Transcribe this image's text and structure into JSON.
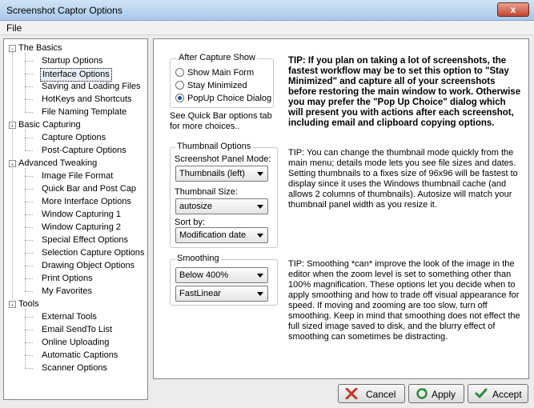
{
  "window": {
    "title": "Screenshot Captor Options",
    "close": "x"
  },
  "menubar": {
    "file": "File"
  },
  "tree": [
    {
      "label": "The Basics",
      "level": 0,
      "expander": "-"
    },
    {
      "label": "Startup Options",
      "level": 1
    },
    {
      "label": "Interface Options",
      "level": 1,
      "selected": true
    },
    {
      "label": "Saving and Loading Files",
      "level": 1
    },
    {
      "label": "HotKeys and Shortcuts",
      "level": 1
    },
    {
      "label": "File Naming Template",
      "level": 1
    },
    {
      "label": "Basic Capturing",
      "level": 0,
      "expander": "-"
    },
    {
      "label": "Capture Options",
      "level": 1
    },
    {
      "label": "Post-Capture Options",
      "level": 1
    },
    {
      "label": "Advanced Tweaking",
      "level": 0,
      "expander": "-"
    },
    {
      "label": "Image File Format",
      "level": 1
    },
    {
      "label": "Quick Bar and Post Cap",
      "level": 1
    },
    {
      "label": "More Interface Options",
      "level": 1
    },
    {
      "label": "Window Capturing 1",
      "level": 1
    },
    {
      "label": "Window Capturing 2",
      "level": 1
    },
    {
      "label": "Special Effect Options",
      "level": 1
    },
    {
      "label": "Selection Capture Options",
      "level": 1
    },
    {
      "label": "Drawing Object Options",
      "level": 1
    },
    {
      "label": "Print Options",
      "level": 1
    },
    {
      "label": "My Favorites",
      "level": 1
    },
    {
      "label": "Tools",
      "level": 0,
      "expander": "-"
    },
    {
      "label": "External Tools",
      "level": 1
    },
    {
      "label": "Email SendTo List",
      "level": 1
    },
    {
      "label": "Online Uploading",
      "level": 1
    },
    {
      "label": "Automatic Captions",
      "level": 1
    },
    {
      "label": "Scanner Options",
      "level": 1
    }
  ],
  "after_capture": {
    "legend": "After Capture Show",
    "options": [
      {
        "label": "Show Main Form",
        "checked": false
      },
      {
        "label": "Stay Minimized",
        "checked": false
      },
      {
        "label": "PopUp Choice Dialog",
        "checked": true
      }
    ],
    "note": "See Quick Bar options tab\nfor more choices.."
  },
  "tip1": "TIP: If you plan on taking a lot of screenshots, the fastest workflow may be to set this option to \"Stay Minimized\" and capture all of your screenshots before restoring the main window to work. Otherwise you may prefer the \"Pop Up Choice\" dialog which will present you with actions after each screenshot, including email and clipboard copying options.",
  "thumbnail": {
    "legend": "Thumbnail Options",
    "panel_mode_label": "Screenshot Panel Mode:",
    "panel_mode_value": "Thumbnails (left)",
    "size_label": "Thumbnail Size:",
    "size_value": "autosize",
    "sort_label": "Sort by:",
    "sort_value": "Modification date"
  },
  "tip2": "TIP: You can change the thumbnail mode quickly from the main menu; details mode lets you see file sizes and dates. Setting thumbnails to a fixes size of 96x96 will be fastest to display since it uses the Windows thumbnail cache (and allows 2 columns of thumbnails).  Autosize will match your thumbnail panel width as you resize it.",
  "smoothing": {
    "legend": "Smoothing",
    "zoom_value": "Below 400%",
    "method_value": "FastLinear"
  },
  "tip3": "TIP: Smoothing *can* improve the look of the image in the editor when the zoom level is set to something other than 100% magnification.  These options let you decide when to apply smoothing and how to trade off visual appearance for speed.  If moving and zooming are too slow, turn off smoothing.  Keep in mind that smoothing does not effect the full sized image saved to disk, and the blurry effect of smoothing can sometimes be distracting.",
  "buttons": {
    "cancel": "Cancel",
    "apply": "Apply",
    "accept": "Accept"
  },
  "colors": {
    "accent": "#1b4f9c",
    "cancel_icon": "#c0392b",
    "apply_icon": "#2e8b3a",
    "accept_icon": "#2e8b3a"
  }
}
